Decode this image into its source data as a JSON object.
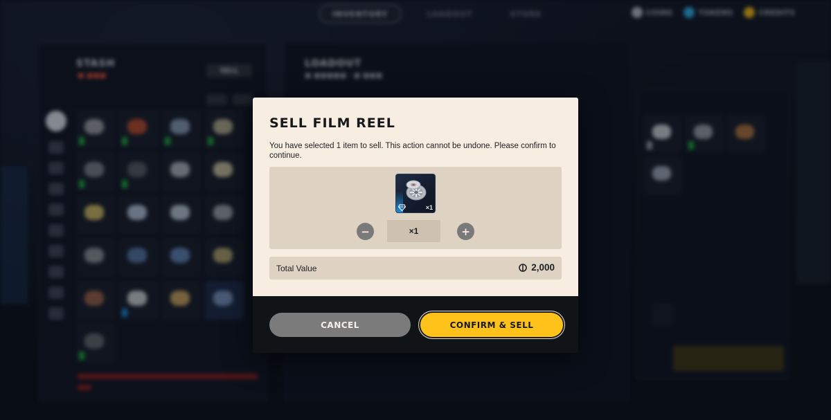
{
  "background": {
    "nav_tabs": [
      "INVENTORY",
      "LOADOUT",
      "STORE"
    ],
    "currencies": [
      "COINS",
      "TOKENS",
      "CREDITS"
    ],
    "currency_colors": {
      "coins": "#a7adb8",
      "tokens": "#2f9fd6",
      "credits": "#e0a818"
    },
    "stash_title": "STASH",
    "loadout_title": "LOADOUT",
    "sell_button": "SELL",
    "status_red": "#c94b2f"
  },
  "dialog": {
    "title": "SELL FILM REEL",
    "description": "You have selected 1 item to sell. This action cannot be undone. Please confirm to continue.",
    "item": {
      "name": "Film Reel",
      "icon": "film-reel-icon",
      "rarity_color": "#1f8dd6",
      "quantity_badge": "×1"
    },
    "stepper": {
      "minus_symbol": "−",
      "plus_symbol": "+",
      "value": "×1"
    },
    "total": {
      "label": "Total Value",
      "currency_icon": "coin-icon",
      "value": "2,000"
    },
    "buttons": {
      "cancel": "CANCEL",
      "confirm": "CONFIRM & SELL"
    },
    "colors": {
      "body_bg": "#f8ede1",
      "panel_bg": "#ded2c3",
      "confirm_bg": "#ffc21a",
      "cancel_bg": "#7b7b7b"
    }
  }
}
